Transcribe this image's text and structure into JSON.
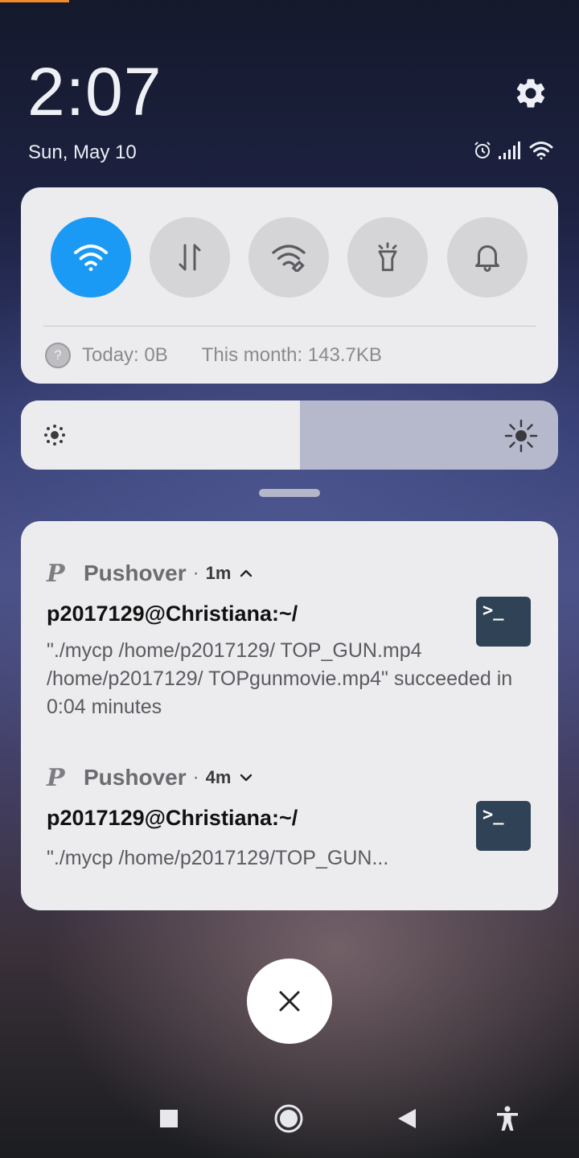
{
  "status_bar": {
    "clock": "2:07",
    "date": "Sun, May 10"
  },
  "icons": {
    "settings": "gear-icon",
    "alarm": "alarm-icon",
    "signal": "signal-icon",
    "wifi_status": "wifi-icon"
  },
  "quick_settings": {
    "toggles": [
      {
        "name": "wifi-toggle",
        "icon": "wifi-icon",
        "active": true
      },
      {
        "name": "mobile-data-toggle",
        "icon": "data-transfer-icon",
        "active": false
      },
      {
        "name": "hotspot-toggle",
        "icon": "hotspot-icon",
        "active": false
      },
      {
        "name": "flashlight-toggle",
        "icon": "flashlight-icon",
        "active": false
      },
      {
        "name": "ringer-toggle",
        "icon": "bell-icon",
        "active": false
      }
    ],
    "data_usage": {
      "icon_glyph": "?",
      "today": "Today: 0B",
      "month": "This month: 143.7KB"
    }
  },
  "brightness": {
    "level": 0.52
  },
  "notifications": [
    {
      "app": "Pushover",
      "logo": "P",
      "separator": "·",
      "time": "1m",
      "expanded": true,
      "title": "p2017129@Christiana:~/",
      "body": "\"./mycp /home/p2017129/ TOP_GUN.mp4 /home/p2017129/ TOPgunmovie.mp4\" succeeded in 0:04 minutes",
      "thumb": ">_"
    },
    {
      "app": "Pushover",
      "logo": "P",
      "separator": "·",
      "time": "4m",
      "expanded": false,
      "title": "p2017129@Christiana:~/",
      "body": "\"./mycp /home/p2017129/TOP_GUN...",
      "thumb": ">_"
    }
  ],
  "colors": {
    "accent": "#1a9af5",
    "panel": "#ececef",
    "thumb_bg": "#2f4256",
    "top_accent": "#f08a2a"
  }
}
